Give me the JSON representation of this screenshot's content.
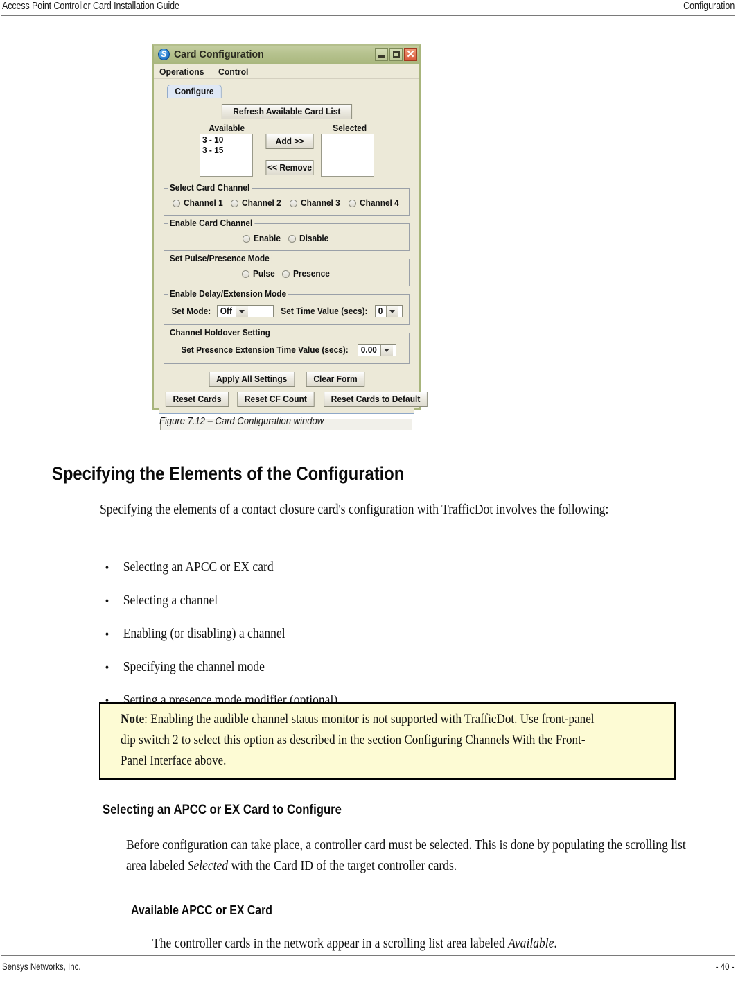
{
  "header": {
    "left": "Access Point Controller Card Installation Guide",
    "right": "Configuration"
  },
  "footer": {
    "left": "Sensys Networks, Inc.",
    "right": "- 40 -"
  },
  "window": {
    "title": "Card Configuration",
    "icon": "app-logo-icon",
    "controls": {
      "minimize": "_",
      "maximize": "□",
      "close": "✕"
    },
    "menus": [
      "Operations",
      "Control"
    ],
    "tab": "Configure",
    "refresh_button": "Refresh Available Card List",
    "lists": {
      "available_label": "Available",
      "selected_label": "Selected",
      "available_items": [
        "3 - 10",
        "3 - 15"
      ],
      "selected_items": [],
      "add_button": "Add >>",
      "remove_button": "<< Remove"
    },
    "groups": [
      {
        "title": "Select Card Channel",
        "options": [
          "Channel 1",
          "Channel 2",
          "Channel 3",
          "Channel 4"
        ]
      },
      {
        "title": "Enable Card Channel",
        "options": [
          "Enable",
          "Disable"
        ]
      },
      {
        "title": "Set Pulse/Presence Mode",
        "options": [
          "Pulse",
          "Presence"
        ]
      }
    ],
    "delay_group": {
      "title": "Enable Delay/Extension Mode",
      "mode_label": "Set Mode:",
      "mode_value": "Off",
      "time_label": "Set Time Value (secs):",
      "time_value": "0"
    },
    "holdover_group": {
      "title": "Channel Holdover Setting",
      "label": "Set Presence Extension Time Value (secs):",
      "value": "0.00"
    },
    "actions_row1": [
      "Apply All Settings",
      "Clear Form"
    ],
    "actions_row2": [
      "Reset Cards",
      "Reset CF Count",
      "Reset Cards to Default"
    ],
    "status_text": ""
  },
  "figure_caption": "Figure 7.12 – Card Configuration window",
  "sections": {
    "h1": "Specifying the Elements of the Configuration",
    "intro": "Specifying the elements of a contact closure card's configuration with TrafficDot involves the following:",
    "bullets": [
      "Selecting an APCC or EX card",
      "Selecting a channel",
      "Enabling (or disabling) a channel",
      "Specifying the channel mode",
      "Setting a presence mode modifier (optional)"
    ],
    "note_prefix": "Note",
    "note_body": ": Enabling the audible channel status monitor is not supported with TrafficDot. Use front-panel dip switch 2 to select this option as described in the section Configuring Channels With the Front-Panel Interface above.",
    "h2": "Selecting an APCC or EX Card to Configure",
    "para2_a": "Before configuration can take place, a controller card must be selected. This is done by populating the scrolling list area labeled ",
    "para2_italic": "Selected",
    "para2_b": " with the Card ID of the target controller cards.",
    "h3": "Available APCC or EX Card",
    "para3_a": "The controller cards in the network appear in a scrolling list area labeled ",
    "para3_italic": "Available",
    "para3_b": "."
  }
}
